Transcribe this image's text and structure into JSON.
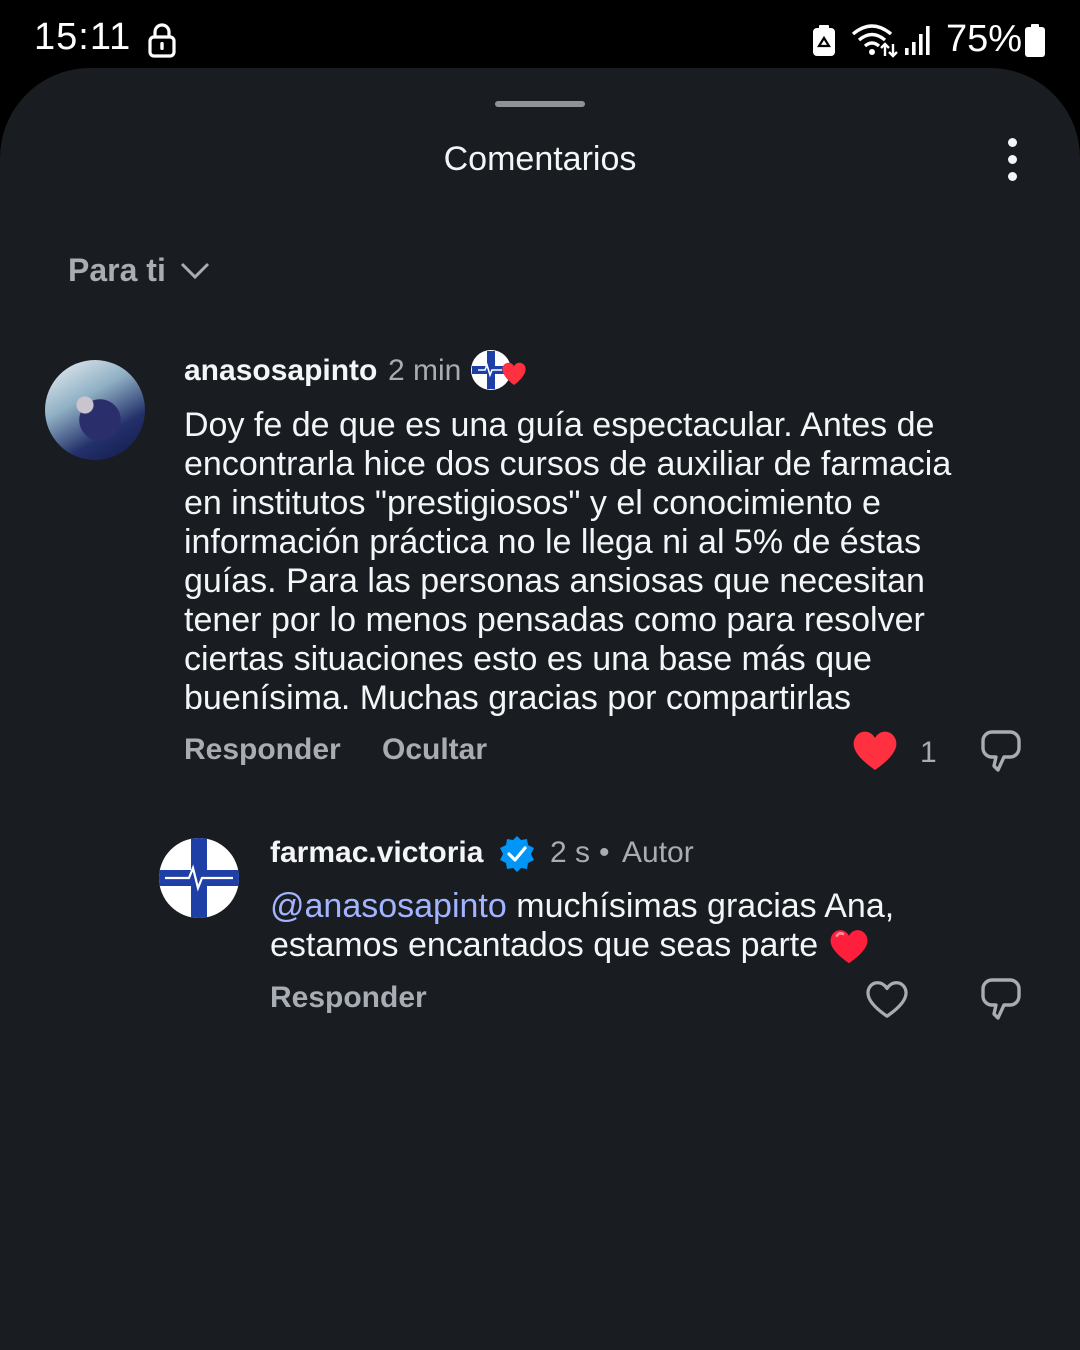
{
  "status_bar": {
    "time": "15:11",
    "battery": "75%"
  },
  "sheet": {
    "title": "Comentarios",
    "sort_label": "Para ti"
  },
  "comments": [
    {
      "username": "anasosapinto",
      "time": "2 min",
      "text_lines": [
        "Doy fe de que es una guía espectacular. Antes de",
        "encontrarla hice dos cursos de auxiliar de farmacia",
        "en institutos \"prestigiosos\" y el conocimiento e",
        "información práctica no le llega ni al 5% de éstas",
        "guías. Para las personas ansiosas que necesitan",
        "tener por lo menos pensadas como para resolver",
        "ciertas situaciones esto es una base más que",
        "buenísima. Muchas gracias por compartirlas"
      ],
      "reply_label": "Responder",
      "hide_label": "Ocultar",
      "likes": "1",
      "liked": true,
      "liked_by_author": true
    }
  ],
  "reply": {
    "username": "farmac.victoria",
    "verified": true,
    "time": "2 s",
    "separator": "•",
    "author_label": "Autor",
    "mention": "@anasosapinto",
    "text_line1": " muchísimas gracias Ana,",
    "text_line2": "estamos encantados que seas parte",
    "emoji": "heart",
    "reply_label": "Responder",
    "liked": false
  },
  "colors": {
    "background": "#191c20",
    "text": "#f3f5f7",
    "muted": "#a8adb3",
    "mention": "#a2b4ff",
    "like_red": "#ff3040",
    "verified_blue": "#0095f6",
    "logo_blue": "#1d3fa6"
  }
}
